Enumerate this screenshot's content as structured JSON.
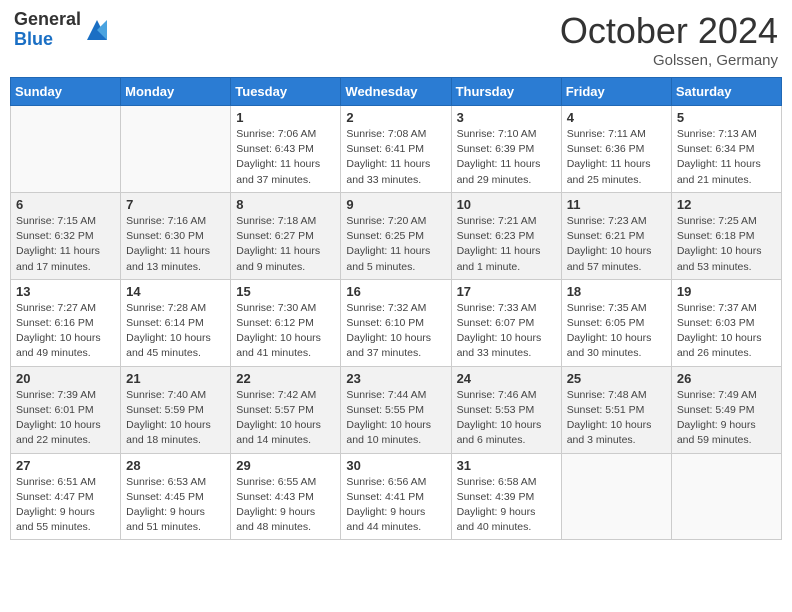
{
  "header": {
    "logo_line1": "General",
    "logo_line2": "Blue",
    "month": "October 2024",
    "location": "Golssen, Germany"
  },
  "days_of_week": [
    "Sunday",
    "Monday",
    "Tuesday",
    "Wednesday",
    "Thursday",
    "Friday",
    "Saturday"
  ],
  "weeks": [
    [
      {
        "day": "",
        "info": ""
      },
      {
        "day": "",
        "info": ""
      },
      {
        "day": "1",
        "info": "Sunrise: 7:06 AM\nSunset: 6:43 PM\nDaylight: 11 hours and 37 minutes."
      },
      {
        "day": "2",
        "info": "Sunrise: 7:08 AM\nSunset: 6:41 PM\nDaylight: 11 hours and 33 minutes."
      },
      {
        "day": "3",
        "info": "Sunrise: 7:10 AM\nSunset: 6:39 PM\nDaylight: 11 hours and 29 minutes."
      },
      {
        "day": "4",
        "info": "Sunrise: 7:11 AM\nSunset: 6:36 PM\nDaylight: 11 hours and 25 minutes."
      },
      {
        "day": "5",
        "info": "Sunrise: 7:13 AM\nSunset: 6:34 PM\nDaylight: 11 hours and 21 minutes."
      }
    ],
    [
      {
        "day": "6",
        "info": "Sunrise: 7:15 AM\nSunset: 6:32 PM\nDaylight: 11 hours and 17 minutes."
      },
      {
        "day": "7",
        "info": "Sunrise: 7:16 AM\nSunset: 6:30 PM\nDaylight: 11 hours and 13 minutes."
      },
      {
        "day": "8",
        "info": "Sunrise: 7:18 AM\nSunset: 6:27 PM\nDaylight: 11 hours and 9 minutes."
      },
      {
        "day": "9",
        "info": "Sunrise: 7:20 AM\nSunset: 6:25 PM\nDaylight: 11 hours and 5 minutes."
      },
      {
        "day": "10",
        "info": "Sunrise: 7:21 AM\nSunset: 6:23 PM\nDaylight: 11 hours and 1 minute."
      },
      {
        "day": "11",
        "info": "Sunrise: 7:23 AM\nSunset: 6:21 PM\nDaylight: 10 hours and 57 minutes."
      },
      {
        "day": "12",
        "info": "Sunrise: 7:25 AM\nSunset: 6:18 PM\nDaylight: 10 hours and 53 minutes."
      }
    ],
    [
      {
        "day": "13",
        "info": "Sunrise: 7:27 AM\nSunset: 6:16 PM\nDaylight: 10 hours and 49 minutes."
      },
      {
        "day": "14",
        "info": "Sunrise: 7:28 AM\nSunset: 6:14 PM\nDaylight: 10 hours and 45 minutes."
      },
      {
        "day": "15",
        "info": "Sunrise: 7:30 AM\nSunset: 6:12 PM\nDaylight: 10 hours and 41 minutes."
      },
      {
        "day": "16",
        "info": "Sunrise: 7:32 AM\nSunset: 6:10 PM\nDaylight: 10 hours and 37 minutes."
      },
      {
        "day": "17",
        "info": "Sunrise: 7:33 AM\nSunset: 6:07 PM\nDaylight: 10 hours and 33 minutes."
      },
      {
        "day": "18",
        "info": "Sunrise: 7:35 AM\nSunset: 6:05 PM\nDaylight: 10 hours and 30 minutes."
      },
      {
        "day": "19",
        "info": "Sunrise: 7:37 AM\nSunset: 6:03 PM\nDaylight: 10 hours and 26 minutes."
      }
    ],
    [
      {
        "day": "20",
        "info": "Sunrise: 7:39 AM\nSunset: 6:01 PM\nDaylight: 10 hours and 22 minutes."
      },
      {
        "day": "21",
        "info": "Sunrise: 7:40 AM\nSunset: 5:59 PM\nDaylight: 10 hours and 18 minutes."
      },
      {
        "day": "22",
        "info": "Sunrise: 7:42 AM\nSunset: 5:57 PM\nDaylight: 10 hours and 14 minutes."
      },
      {
        "day": "23",
        "info": "Sunrise: 7:44 AM\nSunset: 5:55 PM\nDaylight: 10 hours and 10 minutes."
      },
      {
        "day": "24",
        "info": "Sunrise: 7:46 AM\nSunset: 5:53 PM\nDaylight: 10 hours and 6 minutes."
      },
      {
        "day": "25",
        "info": "Sunrise: 7:48 AM\nSunset: 5:51 PM\nDaylight: 10 hours and 3 minutes."
      },
      {
        "day": "26",
        "info": "Sunrise: 7:49 AM\nSunset: 5:49 PM\nDaylight: 9 hours and 59 minutes."
      }
    ],
    [
      {
        "day": "27",
        "info": "Sunrise: 6:51 AM\nSunset: 4:47 PM\nDaylight: 9 hours and 55 minutes."
      },
      {
        "day": "28",
        "info": "Sunrise: 6:53 AM\nSunset: 4:45 PM\nDaylight: 9 hours and 51 minutes."
      },
      {
        "day": "29",
        "info": "Sunrise: 6:55 AM\nSunset: 4:43 PM\nDaylight: 9 hours and 48 minutes."
      },
      {
        "day": "30",
        "info": "Sunrise: 6:56 AM\nSunset: 4:41 PM\nDaylight: 9 hours and 44 minutes."
      },
      {
        "day": "31",
        "info": "Sunrise: 6:58 AM\nSunset: 4:39 PM\nDaylight: 9 hours and 40 minutes."
      },
      {
        "day": "",
        "info": ""
      },
      {
        "day": "",
        "info": ""
      }
    ]
  ]
}
